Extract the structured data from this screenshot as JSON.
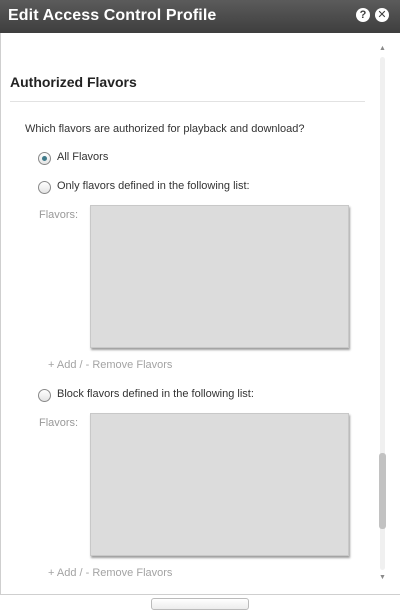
{
  "dialog": {
    "title": "Edit Access Control Profile",
    "help_icon": "question-mark-icon",
    "close_icon": "close-x-icon"
  },
  "section": {
    "title": "Authorized Flavors",
    "question": "Which flavors are authorized for playback and download?"
  },
  "options": {
    "all": {
      "label": "All Flavors",
      "selected": true
    },
    "allow_list": {
      "label": "Only flavors defined in the following list:",
      "selected": false
    },
    "block_list": {
      "label": "Block flavors defined in the following list:",
      "selected": false
    }
  },
  "allow_list": {
    "field_label": "Flavors:",
    "actions": "+ Add / - Remove Flavors"
  },
  "block_list": {
    "field_label": "Flavors:",
    "actions": "+ Add / - Remove Flavors"
  },
  "colors": {
    "titlebar": "#4a4a4a",
    "listbox": "#dcdcdc",
    "radio_dot": "#3f7a8a",
    "muted_text": "#a3a3a3"
  }
}
